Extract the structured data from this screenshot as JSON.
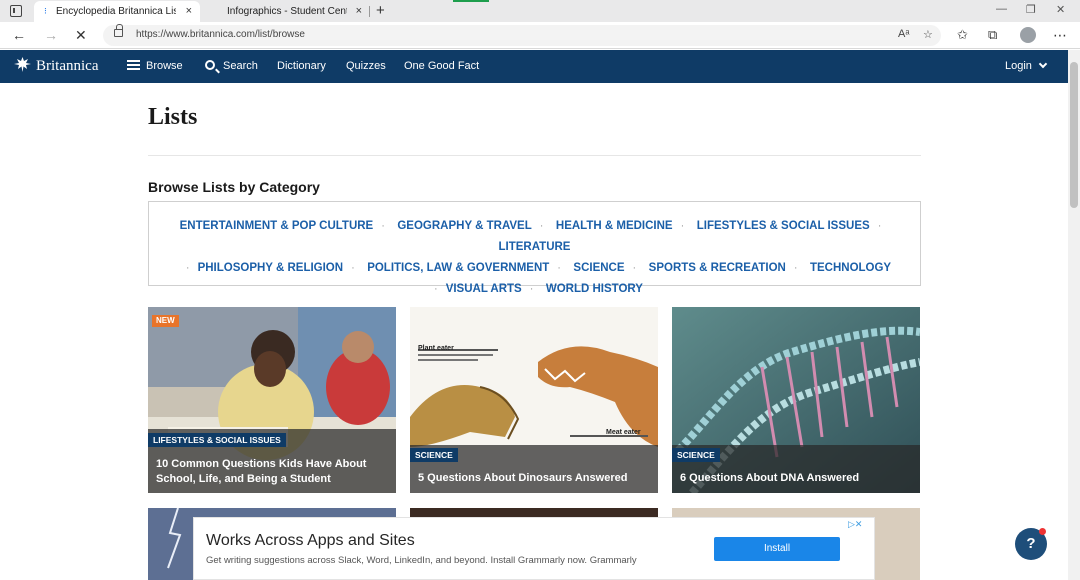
{
  "browser": {
    "tabs": [
      {
        "title": "Encyclopedia Britannica Lists | Br",
        "active": true
      },
      {
        "title": "Infographics - Student Center | B",
        "active": false
      }
    ],
    "url": "https://www.britannica.com/list/browse",
    "close_glyph": "×",
    "new_tab_glyph": "+"
  },
  "site_nav": {
    "logo": "Britannica",
    "items": [
      "Browse",
      "Search",
      "Dictionary",
      "Quizzes",
      "One Good Fact"
    ],
    "login": "Login"
  },
  "page": {
    "title": "Lists",
    "section_title": "Browse Lists by Category",
    "categories": [
      "ENTERTAINMENT & POP CULTURE",
      "GEOGRAPHY & TRAVEL",
      "HEALTH & MEDICINE",
      "LIFESTYLES & SOCIAL ISSUES",
      "LITERATURE",
      "PHILOSOPHY & RELIGION",
      "POLITICS, LAW & GOVERNMENT",
      "SCIENCE",
      "SPORTS & RECREATION",
      "TECHNOLOGY",
      "VISUAL ARTS",
      "WORLD HISTORY"
    ],
    "cards": [
      {
        "badge": "NEW",
        "category": "LIFESTYLES & SOCIAL ISSUES",
        "title": "10 Common Questions Kids Have About School, Life, and Being a Student"
      },
      {
        "category": "SCIENCE",
        "title": "5 Questions About Dinosaurs Answered",
        "caption_top": "Plant eater",
        "caption_bottom": "Meat eater"
      },
      {
        "category": "SCIENCE",
        "title": "6 Questions About DNA Answered"
      }
    ]
  },
  "ad": {
    "title": "Works Across Apps and Sites",
    "description": "Get writing suggestions across Slack, Word, LinkedIn, and beyond. Install Grammarly now. Grammarly",
    "button": "Install"
  },
  "help_button": "?"
}
